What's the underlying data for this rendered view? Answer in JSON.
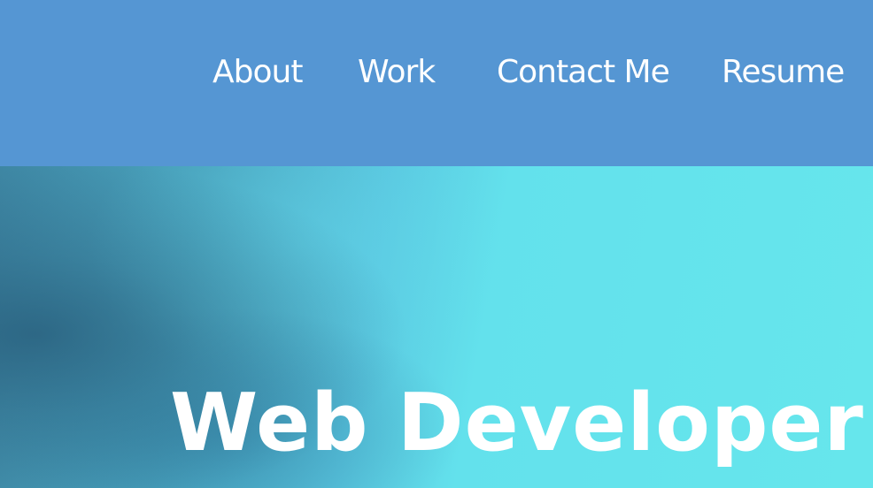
{
  "nav": {
    "items": [
      {
        "label": "About"
      },
      {
        "label": "Work"
      },
      {
        "label": "Contact Me"
      },
      {
        "label": "Resume"
      }
    ]
  },
  "hero": {
    "title": "Web Developer"
  },
  "colors": {
    "nav_background": "#5596d3",
    "hero_accent": "#66e6ec",
    "hero_shadow": "#3f88a5",
    "text": "#ffffff"
  }
}
